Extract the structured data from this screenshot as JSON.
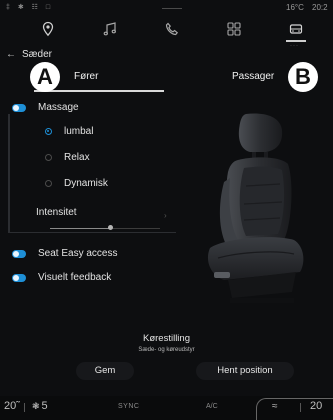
{
  "status_bar": {
    "icons": "‡ ✱ ☷ □",
    "temperature": "16°C",
    "time": "20:2"
  },
  "nav": {
    "items": [
      {
        "icon": "location-pin-icon"
      },
      {
        "icon": "music-note-icon"
      },
      {
        "icon": "phone-icon"
      },
      {
        "icon": "apps-grid-icon"
      },
      {
        "icon": "car-icon",
        "active": true
      }
    ],
    "more": "···"
  },
  "header": {
    "back": "←",
    "title": "Sæder"
  },
  "tabs": {
    "driver": "Fører",
    "passenger": "Passager",
    "callout_a": "A",
    "callout_b": "B"
  },
  "settings": {
    "massage_label": "Massage",
    "massage_on": true,
    "modes": [
      {
        "label": "lumbal",
        "selected": true
      },
      {
        "label": "Relax",
        "selected": false
      },
      {
        "label": "Dynamisk",
        "selected": false
      }
    ],
    "intensity_label": "Intensitet",
    "intensity_level": 0.55,
    "chevron": "›",
    "easy_access_label": "Seat Easy access",
    "easy_access_on": true,
    "feedback_label": "Visuelt feedback",
    "feedback_on": true
  },
  "seat_image": "car-seat-illustration",
  "position": {
    "title": "Kørestilling",
    "subtitle": "Sæde- og køreudstyr",
    "save_label": "Gem",
    "fetch_label": "Hent position"
  },
  "climate": {
    "temp_left": "20̃",
    "fan_icon": "❃",
    "fan_level": "5",
    "sync_label": "SYNC",
    "ac_label": "A/C",
    "seat_heat_icon": "≈",
    "temp_right": "20"
  },
  "colors": {
    "accent": "#1e8fd6",
    "background": "#0d0e10"
  }
}
